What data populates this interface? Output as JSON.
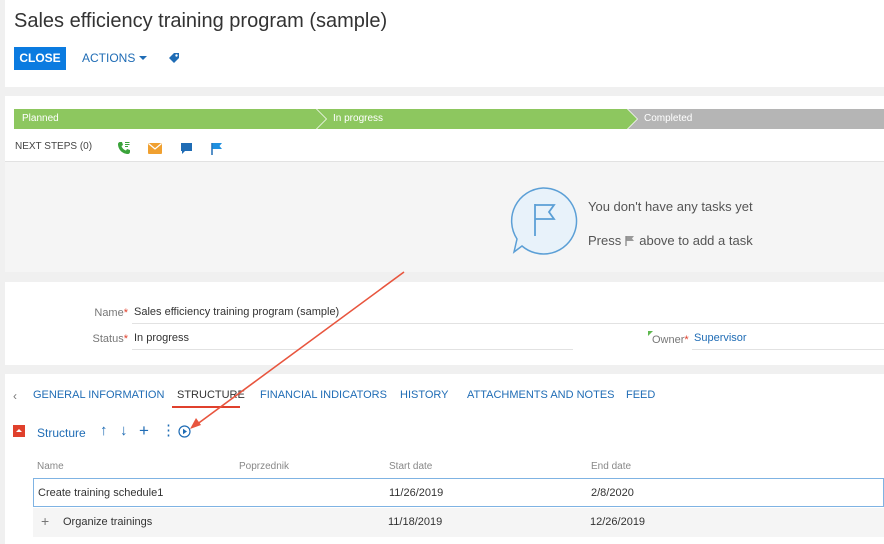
{
  "header": {
    "title": "Sales efficiency training program (sample)",
    "close_label": "CLOSE",
    "actions_label": "ACTIONS",
    "tag_icon": "tag-icon"
  },
  "lifecycle": {
    "stages": [
      {
        "label": "Planned",
        "color": "#8dc75f"
      },
      {
        "label": "In progress",
        "color": "#8dc75f"
      },
      {
        "label": "Completed",
        "color": "#b5b5b5"
      }
    ],
    "next_steps_label": "NEXT STEPS (0)",
    "icons": [
      "call-icon",
      "email-icon",
      "chat-icon",
      "flag-icon"
    ],
    "empty_title": "You don't have any tasks yet",
    "empty_press": "Press",
    "empty_suffix": "above to add a task"
  },
  "fields": {
    "name_label": "Name",
    "name_value": "Sales efficiency training program (sample)",
    "status_label": "Status",
    "status_value": "In progress",
    "owner_label": "Owner",
    "owner_value": "Supervisor",
    "required_mark": "*"
  },
  "tabs": [
    {
      "label": "GENERAL INFORMATION",
      "active": false
    },
    {
      "label": "STRUCTURE",
      "active": true
    },
    {
      "label": "FINANCIAL INDICATORS",
      "active": false
    },
    {
      "label": "HISTORY",
      "active": false
    },
    {
      "label": "ATTACHMENTS AND NOTES",
      "active": false
    },
    {
      "label": "FEED",
      "active": false
    }
  ],
  "structure": {
    "title": "Structure",
    "toolbar": {
      "up": "↑",
      "down": "↓",
      "add": "+",
      "more": "⋮"
    },
    "columns": [
      "Name",
      "Poprzednik",
      "Start date",
      "End date"
    ],
    "rows": [
      {
        "name": "Create training schedule1",
        "predecessor": "",
        "start": "11/26/2019",
        "end": "2/8/2020"
      },
      {
        "name": "Organize trainings",
        "predecessor": "",
        "start": "11/18/2019",
        "end": "12/26/2019"
      }
    ]
  },
  "colors": {
    "accent": "#0b7be0",
    "link": "#1f6cb5",
    "required": "#e0402c",
    "stage_done": "#8dc75f",
    "stage_pending": "#b5b5b5",
    "annotation_arrow": "#e8553e"
  }
}
